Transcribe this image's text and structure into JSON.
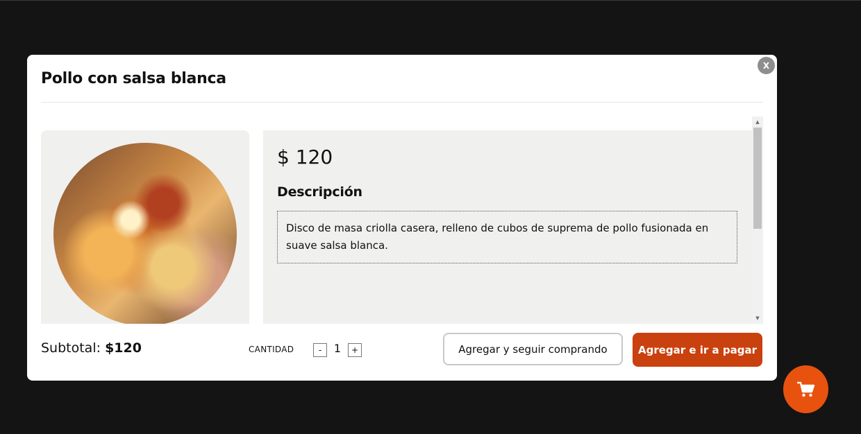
{
  "modal": {
    "title": "Pollo con salsa blanca",
    "close_label": "X",
    "image_alt": "Pollo con salsa blanca",
    "price": "$ 120",
    "description_title": "Descripción",
    "description": "Disco de masa criolla casera, relleno de cubos de suprema de pollo fusionada en suave salsa blanca."
  },
  "footer": {
    "subtotal_label": "Subtotal:",
    "subtotal_value": "$120",
    "quantity_label": "CANTIDAD",
    "decrement_label": "-",
    "quantity_value": "1",
    "increment_label": "+",
    "add_continue_label": "Agregar y seguir comprando",
    "add_pay_label": "Agregar e ir a pagar"
  },
  "icons": {
    "close": "close-icon",
    "cart": "cart-icon",
    "scroll_up": "scroll-up-arrow-icon",
    "scroll_down": "scroll-down-arrow-icon"
  },
  "colors": {
    "overlay": "#141414",
    "accent": "#c9410f",
    "cart_button": "#e8520f",
    "panel": "#f0f0ef"
  }
}
